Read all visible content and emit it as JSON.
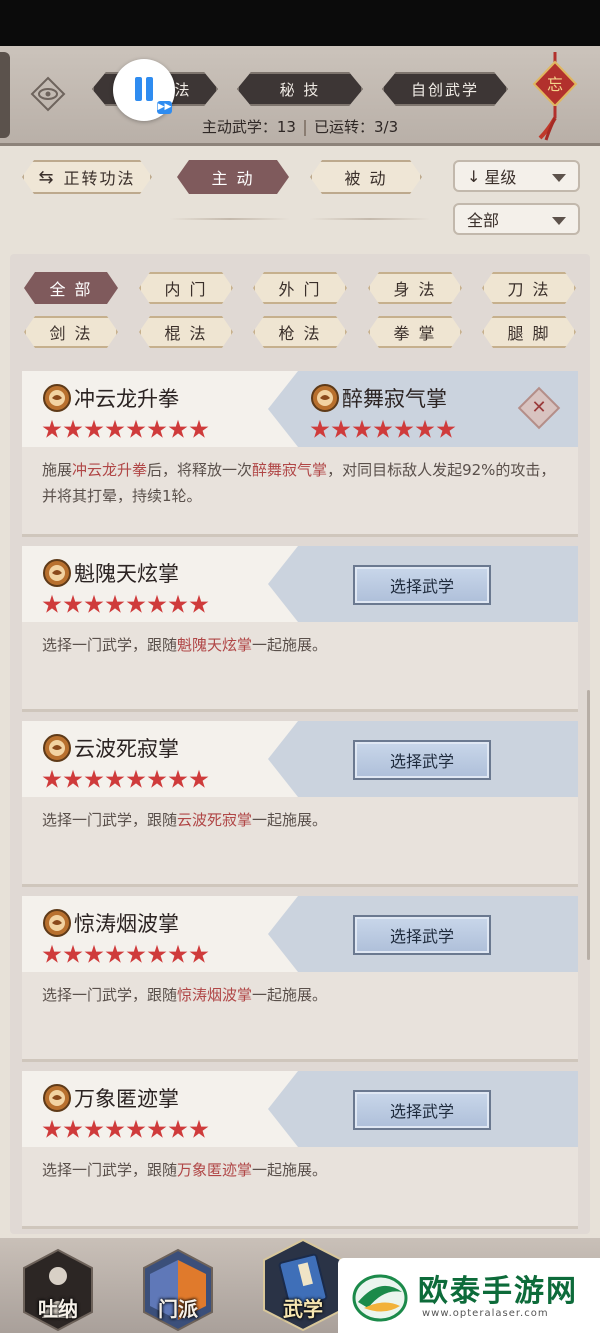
{
  "header": {
    "tabs": [
      {
        "label": "法"
      },
      {
        "label": "秘 技"
      },
      {
        "label": "自创武学"
      }
    ],
    "pause_overlay": {
      "ff_icon": "fast-forward-icon"
    },
    "stats": {
      "active_label": "主动武学：13",
      "running_label": "已运转：3/3"
    },
    "knot_char": "忘"
  },
  "filters": {
    "rotate_label": "正转功法",
    "active_label": "主 动",
    "passive_label": "被 动",
    "sort_label": "星级",
    "range_label": "全部"
  },
  "categories": [
    {
      "label": "全 部",
      "selected": true
    },
    {
      "label": "内 门",
      "selected": false
    },
    {
      "label": "外 门",
      "selected": false
    },
    {
      "label": "身 法",
      "selected": false
    },
    {
      "label": "刀 法",
      "selected": false
    },
    {
      "label": "剑 法",
      "selected": false
    },
    {
      "label": "棍 法",
      "selected": false
    },
    {
      "label": "枪 法",
      "selected": false
    },
    {
      "label": "拳 掌",
      "selected": false
    },
    {
      "label": "腿 脚",
      "selected": false
    }
  ],
  "cards": [
    {
      "name": "冲云龙升拳",
      "stars": 8,
      "paired_name": "醉舞寂气掌",
      "paired_stars": 7,
      "desc": {
        "p1": "施展",
        "h1": "冲云龙升拳",
        "p2": "后，将释放一次",
        "h2": "醉舞寂气掌",
        "p3": "，对同目标敌人发起92%的攻击，并将其打晕，持续1轮。"
      }
    },
    {
      "name": "魁隗天炫掌",
      "stars": 8,
      "button": "选择武学",
      "desc": {
        "p1": "选择一门武学，跟随",
        "h1": "魁隗天炫掌",
        "p2": "一起施展。"
      }
    },
    {
      "name": "云波死寂掌",
      "stars": 8,
      "button": "选择武学",
      "desc": {
        "p1": "选择一门武学，跟随",
        "h1": "云波死寂掌",
        "p2": "一起施展。"
      }
    },
    {
      "name": "惊涛烟波掌",
      "stars": 8,
      "button": "选择武学",
      "desc": {
        "p1": "选择一门武学，跟随",
        "h1": "惊涛烟波掌",
        "p2": "一起施展。"
      }
    },
    {
      "name": "万象匿迹掌",
      "stars": 8,
      "button": "选择武学",
      "desc": {
        "p1": "选择一门武学，跟随",
        "h1": "万象匿迹掌",
        "p2": "一起施展。"
      }
    }
  ],
  "bottom_nav": [
    {
      "label": "吐纳"
    },
    {
      "label": "门派"
    },
    {
      "label": "武学"
    }
  ],
  "watermark": {
    "title": "欧泰手游网",
    "url": "www.opteralaser.com"
  },
  "colors": {
    "accent_dark": "#7f5a5c",
    "star_red": "#cf3b3b",
    "highlight_red": "#b04646",
    "button_blue": "#aebfd9"
  }
}
